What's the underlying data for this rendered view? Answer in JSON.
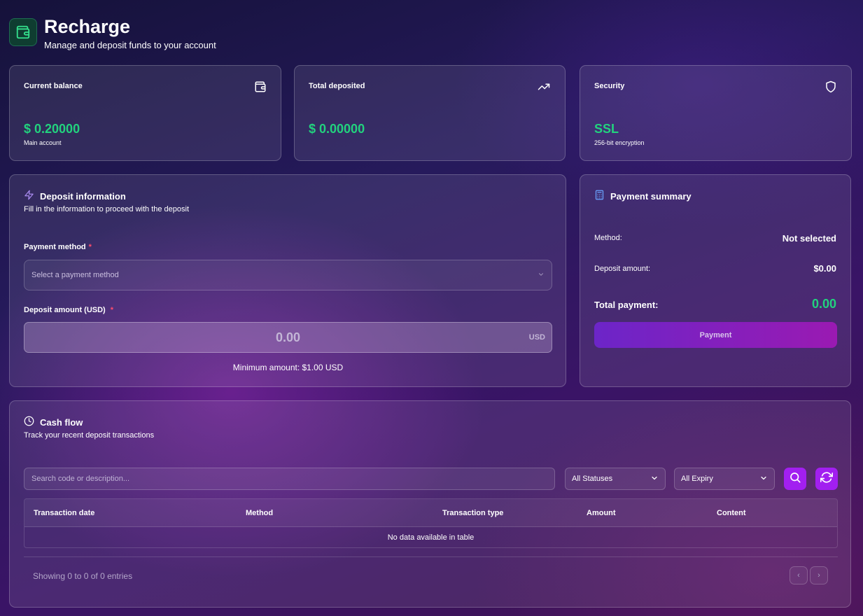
{
  "header": {
    "title": "Recharge",
    "subtitle": "Manage and deposit funds to your account",
    "icon": "wallet-icon"
  },
  "stats": [
    {
      "label": "Current balance",
      "value": "$ 0.20000",
      "sub": "Main account",
      "icon": "wallet-icon"
    },
    {
      "label": "Total deposited",
      "value": "$ 0.00000",
      "sub": "",
      "icon": "trending-up-icon"
    },
    {
      "label": "Security",
      "value": "SSL",
      "sub": "256-bit encryption",
      "icon": "shield-icon"
    }
  ],
  "deposit": {
    "title": "Deposit information",
    "subtitle": "Fill in the information to proceed with the deposit",
    "method_label": "Payment method",
    "method_placeholder": "Select a payment method",
    "amount_label": "Deposit amount (USD)",
    "amount_value": "0.00",
    "amount_unit": "USD",
    "required_mark": "*",
    "min_amount": "Minimum amount: $1.00 USD"
  },
  "summary": {
    "title": "Payment summary",
    "method_label": "Method:",
    "method_value": "Not selected",
    "amount_label": "Deposit amount:",
    "amount_value": "$0.00",
    "total_label": "Total payment:",
    "total_value": "0.00",
    "pay_button": "Payment"
  },
  "cashflow": {
    "title": "Cash flow",
    "subtitle": "Track your recent deposit transactions",
    "search_placeholder": "Search code or description...",
    "status_filter": "All Statuses",
    "expiry_filter": "All Expiry",
    "columns": [
      "Transaction date",
      "Method",
      "Transaction type",
      "Amount",
      "Content"
    ],
    "empty_message": "No data available in table",
    "entries_info": "Showing 0 to 0 of 0 entries",
    "prev_label": "‹",
    "next_label": "›"
  },
  "colors": {
    "accent_green": "#22d27e",
    "accent_purple": "#a21ff0",
    "required_red": "#ff4d6d"
  }
}
